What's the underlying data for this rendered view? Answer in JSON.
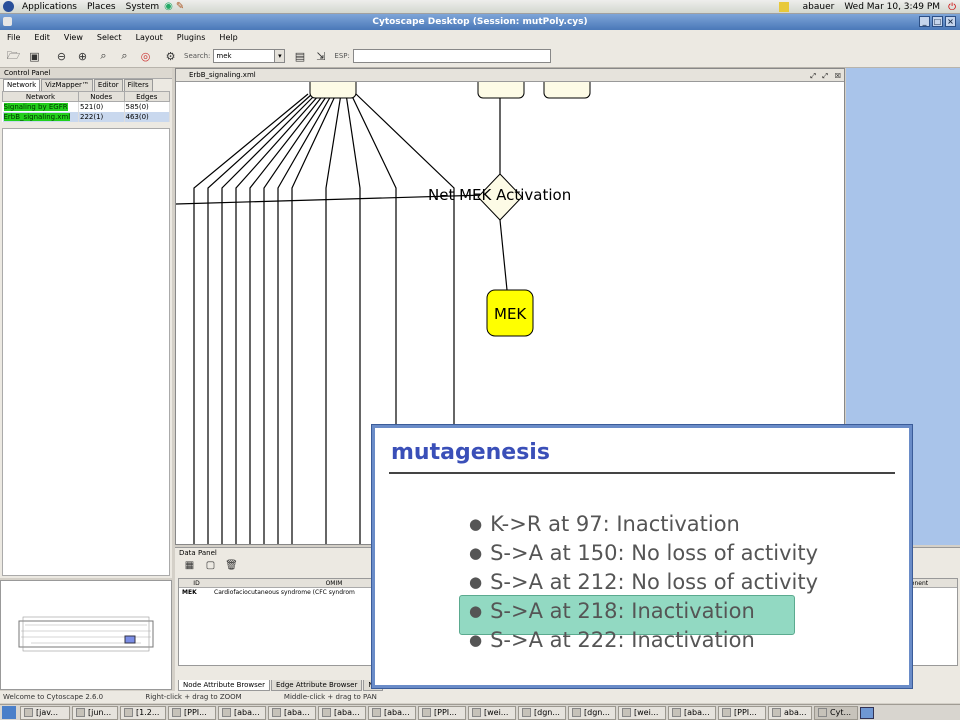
{
  "top_panel": {
    "menus": [
      "Applications",
      "Places",
      "System"
    ],
    "user": "abauer",
    "datetime": "Wed Mar 10, 3:49 PM"
  },
  "window": {
    "title": "Cytoscape Desktop (Session: mutPoly.cys)"
  },
  "menubar": [
    "File",
    "Edit",
    "View",
    "Select",
    "Layout",
    "Plugins",
    "Help"
  ],
  "toolbar": {
    "search_label": "Search:",
    "search_value": "mek",
    "esp_label": "ESP:",
    "esp_value": ""
  },
  "control_panel": {
    "title": "Control Panel",
    "tabs": [
      "Network",
      "VizMapper™",
      "Editor",
      "Filters"
    ],
    "columns": [
      "Network",
      "Nodes",
      "Edges"
    ],
    "rows": [
      {
        "name": "Signaling by EGFR",
        "nodes": "521(0)",
        "edges": "585(0)"
      },
      {
        "name": "ErbB_signaling.xml",
        "nodes": "222(1)",
        "edges": "463(0)"
      }
    ]
  },
  "network_view": {
    "title": "ErbB_signaling.xml",
    "node_label_mek": "MEK",
    "node_label_activation": "Net MEK Activation"
  },
  "data_panel": {
    "title": "Data Panel",
    "columns": [
      "ID",
      "OMIM",
      "ponent"
    ],
    "rows": [
      {
        "id": "MEK",
        "omim": "Cardiofaciocutaneous syndrome (CFC syndrom"
      }
    ],
    "tabs": [
      "Node Attribute Browser",
      "Edge Attribute Browser",
      "Ne"
    ]
  },
  "callout": {
    "title": "mutagenesis",
    "items": [
      "K->R at 97: Inactivation",
      "S->A at 150: No loss of activity",
      "S->A at 212: No loss of activity",
      "S->A at 218: Inactivation",
      "S->A at 222: Inactivation"
    ],
    "highlight_index": 3
  },
  "status": [
    "Welcome to Cytoscape 2.6.0",
    "Right-click + drag to ZOOM",
    "Middle-click + drag to PAN"
  ],
  "taskbar": [
    "[jav...",
    "[jun...",
    "[1.2...",
    "[PPI...",
    "[aba...",
    "[aba...",
    "[aba...",
    "[aba...",
    "[PPI...",
    "[wei...",
    "[dgn...",
    "[dgn...",
    "[wei...",
    "[aba...",
    "[PPI...",
    "aba...",
    "Cyt..."
  ]
}
